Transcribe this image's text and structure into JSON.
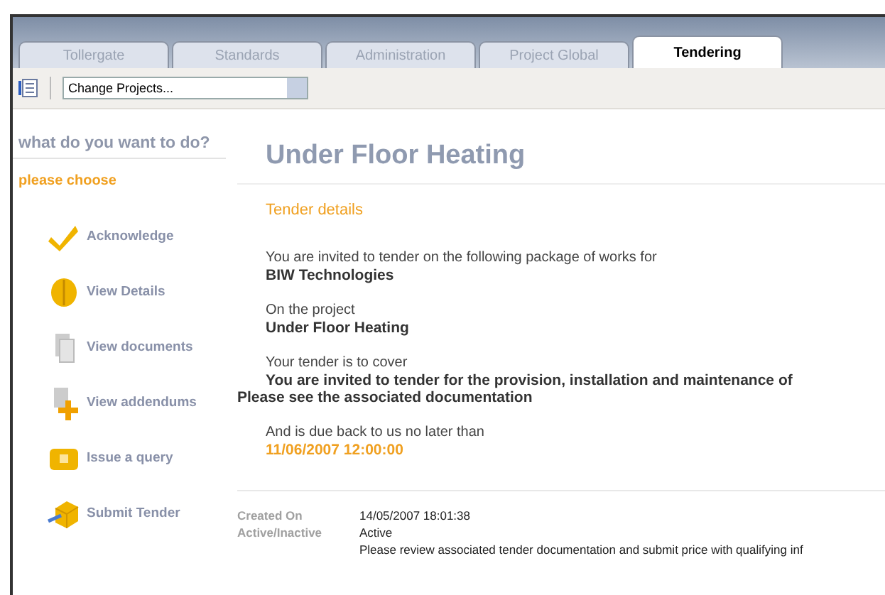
{
  "tabs": [
    {
      "label": "Tollergate",
      "selected": false
    },
    {
      "label": "Standards",
      "selected": false
    },
    {
      "label": "Administration",
      "selected": false
    },
    {
      "label": "Project Global",
      "selected": false
    },
    {
      "label": "Tendering",
      "selected": true
    }
  ],
  "toolbar": {
    "project_select": "Change Projects..."
  },
  "sidebar": {
    "heading": "what do you want to do?",
    "subheading": "please choose",
    "items": [
      {
        "kind": "check",
        "label": "Acknowledge"
      },
      {
        "kind": "details",
        "label": "View Details"
      },
      {
        "kind": "documents",
        "label": "View documents"
      },
      {
        "kind": "addendums",
        "label": "View addendums"
      },
      {
        "kind": "query",
        "label": "Issue a query"
      },
      {
        "kind": "submit",
        "label": "Submit Tender"
      }
    ]
  },
  "main": {
    "title": "Under Floor Heating",
    "section": "Tender details",
    "blocks": [
      {
        "intro": "You are invited to tender on the following package of works for",
        "value": "BIW Technologies"
      },
      {
        "intro": "On the project",
        "value": "Under Floor Heating"
      },
      {
        "intro": "Your tender is to cover",
        "value": "You are invited to tender for the provision, installation and maintenance of",
        "extra": "Please see the associated documentation"
      },
      {
        "intro": "And is due back to us no later than",
        "value": "11/06/2007 12:00:00",
        "highlight": true
      }
    ],
    "details": [
      {
        "label": "Created On",
        "value": "14/05/2007 18:01:38"
      },
      {
        "label": "Active/Inactive",
        "value": "Active"
      },
      {
        "value": "Please review associated tender documentation and submit price with qualifying inf"
      }
    ]
  }
}
